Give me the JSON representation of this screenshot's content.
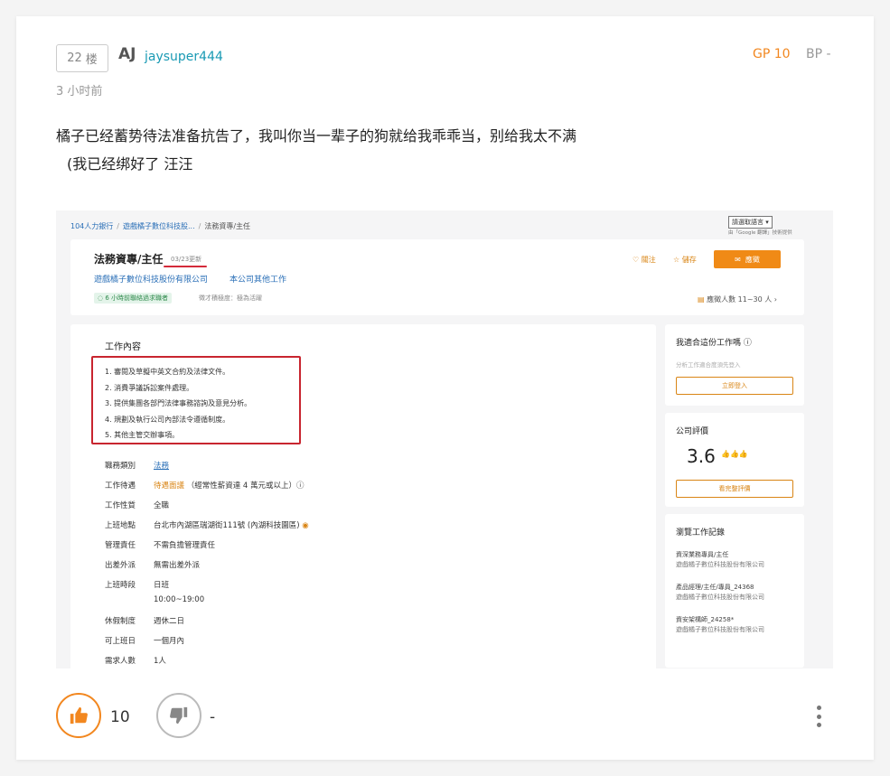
{
  "post": {
    "floor_number": "22",
    "floor_unit": "楼",
    "author_name": "AJ",
    "author_id": "jaysuper444",
    "time": "3 小时前",
    "gp": "GP 10",
    "bp": "BP -",
    "content_line1": "橘子已经蓄势待法准备抗告了，我叫你当一辈子的狗就给我乖乖当，别给我太不满",
    "content_line2": "(我已经绑好了 汪汪"
  },
  "screenshot": {
    "breadcrumb": [
      "104人力銀行",
      "遊戲橘子數位科技股...",
      "法務資專/主任"
    ],
    "lang_select": "請選取語言 ▾",
    "google_note": "由「Google 翻譯」技術提供",
    "job_title": "法務資專/主任",
    "updated": "03/23更新",
    "company": "遊戲橘子數位科技股份有限公司",
    "other_jobs": "本公司其他工作",
    "recent_contact": "6 小時前聯絡過求職者",
    "activity": "徵才積極度：極為活躍",
    "applicants": "應徵人數 11~30 人 ›",
    "follow": "關注",
    "save": "儲存",
    "apply": "應徵",
    "section_title": "工作內容",
    "duties": [
      "1. 審閱及草擬中英文合約及法律文件。",
      "2. 消費爭議訴訟案件處理。",
      "3. 提供集團各部門法律事務諮詢及意見分析。",
      "4. 規劃及執行公司內部法令遵循制度。",
      "5. 其他主管交辦事項。"
    ],
    "fields": {
      "category_k": "職務類別",
      "category_v": "法務",
      "pay_k": "工作待遇",
      "pay_v": "待遇面議",
      "pay_note": "（經常性薪資達 4 萬元或以上）ⓘ",
      "nature_k": "工作性質",
      "nature_v": "全職",
      "location_k": "上班地點",
      "location_v": "台北市內湖區瑞湖街111號 (內湖科技園區)",
      "mgmt_k": "管理責任",
      "mgmt_v": "不需負擔管理責任",
      "trip_k": "出差外派",
      "trip_v": "無需出差外派",
      "shift_k": "上班時段",
      "shift_v": "日班",
      "shift_time": "10:00~19:00",
      "holiday_k": "休假制度",
      "holiday_v": "週休二日",
      "start_k": "可上班日",
      "start_v": "一個月內",
      "headcount_k": "需求人數",
      "headcount_v": "1人"
    },
    "side1_title": "我適合這份工作嗎 ⓘ",
    "side1_hint": "分析工作適合度須先登入",
    "side1_btn": "立即登入",
    "side2_title": "公司評價",
    "rating": "3.6",
    "side2_btn": "看完整評價",
    "side3_title": "瀏覽工作記錄",
    "history": [
      {
        "job": "資深業務專員/主任",
        "company": "遊戲橘子數位科技股份有限公司"
      },
      {
        "job": "產品經理/主任/專員_24368",
        "company": "遊戲橘子數位科技股份有限公司"
      },
      {
        "job": "資安架構師_24258*",
        "company": "遊戲橘子數位科技股份有限公司"
      }
    ]
  },
  "actions": {
    "like_count": "10",
    "dislike_count": "-"
  },
  "colors": {
    "accent": "#f2871f",
    "link": "#1a9ab4",
    "highlight_red": "#c8252f"
  }
}
